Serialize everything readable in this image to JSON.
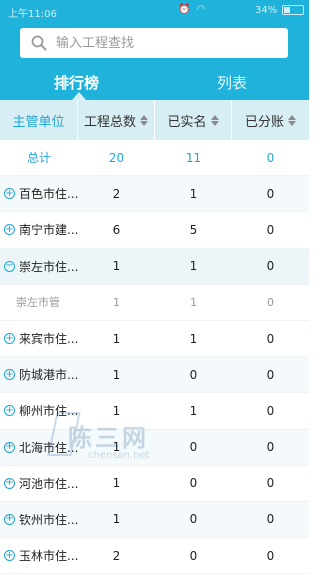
{
  "status_bar": {
    "time": "上午11:06",
    "battery": "34%"
  },
  "search": {
    "placeholder": "输入工程查找"
  },
  "tabs": [
    {
      "label": "排行榜",
      "active": true
    },
    {
      "label": "列表",
      "active": false
    }
  ],
  "table": {
    "headers": [
      "主管单位",
      "工程总数",
      "已实名",
      "已分账"
    ],
    "total_row": {
      "unit": "总计",
      "total": "20",
      "named": "11",
      "split": "0"
    },
    "rows": [
      {
        "icon": "⊕",
        "unit": "百色市住...",
        "total": "2",
        "named": "1",
        "split": "0"
      },
      {
        "icon": "⊕",
        "unit": "南宁市建...",
        "total": "6",
        "named": "5",
        "split": "0"
      },
      {
        "icon": "⊖",
        "unit": "崇左市住...",
        "total": "1",
        "named": "1",
        "split": "0"
      },
      {
        "icon": "",
        "unit": "崇左市管",
        "total": "1",
        "named": "1",
        "split": "0"
      },
      {
        "icon": "⊕",
        "unit": "来宾市住...",
        "total": "1",
        "named": "1",
        "split": "0"
      },
      {
        "icon": "⊕",
        "unit": "防城港市...",
        "total": "1",
        "named": "0",
        "split": "0"
      },
      {
        "icon": "⊕",
        "unit": "柳州市住...",
        "total": "1",
        "named": "1",
        "split": "0"
      },
      {
        "icon": "⊕",
        "unit": "北海市住...",
        "total": "1",
        "named": "0",
        "split": "0"
      },
      {
        "icon": "⊕",
        "unit": "河池市住...",
        "total": "1",
        "named": "0",
        "split": "0"
      },
      {
        "icon": "⊕",
        "unit": "钦州市住...",
        "total": "1",
        "named": "0",
        "split": "0"
      },
      {
        "icon": "⊕",
        "unit": "玉林市住...",
        "total": "2",
        "named": "0",
        "split": "0"
      }
    ]
  },
  "watermark": {
    "main": "陈三网",
    "sub": "chensan.net"
  },
  "colors": {
    "accent": "#1fb3dc",
    "header_bg": "#d7eef5",
    "link": "#1fa6d4"
  }
}
